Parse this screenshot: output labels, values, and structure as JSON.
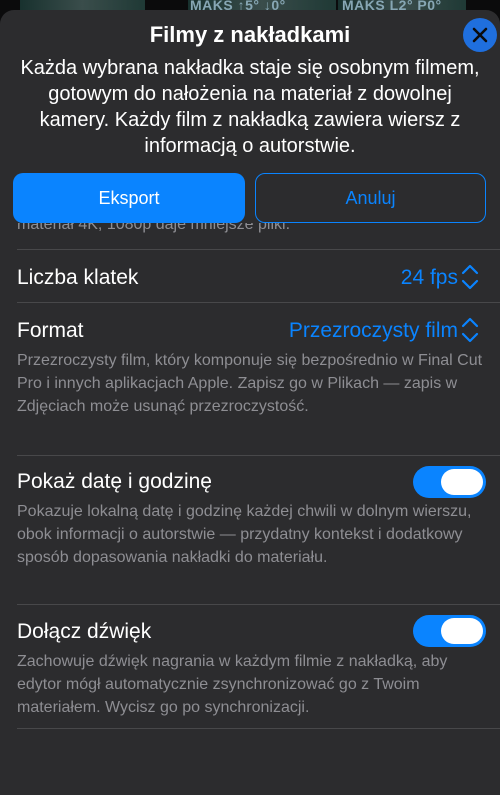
{
  "backdrop": {
    "stat1": "MAKS ↑5° ↓0°",
    "stat2": "MAKS L2° P0°"
  },
  "sheet": {
    "title": "Filmy z nakładkami",
    "description": "Każda wybrana nakładka staje się osobnym filmem, gotowym do nałożenia na materiał z dowolnej kamery. Każdy film z nakładką zawiera wiersz z informacją o autorstwie.",
    "close_icon": "close-x-icon"
  },
  "actions": {
    "export_label": "Eksport",
    "cancel_label": "Anuluj"
  },
  "settings": {
    "clipped_text": "materiał 4K, 1080p daje mniejsze pliki.",
    "frame_rate": {
      "label": "Liczba klatek",
      "value": "24 fps"
    },
    "format": {
      "label": "Format",
      "value": "Przezroczysty film",
      "description": "Przezroczysty film, który komponuje się bezpośrednio w Final Cut Pro i innych aplikacjach Apple. Zapisz go w Plikach — zapis w Zdjęciach może usunąć przezroczystość."
    },
    "show_datetime": {
      "label": "Pokaż datę i godzinę",
      "enabled": true,
      "description": "Pokazuje lokalną datę i godzinę każdej chwili w dolnym wierszu, obok informacji o autorstwie — przydatny kontekst i dodatkowy sposób dopasowania nakładki do materiału."
    },
    "include_sound": {
      "label": "Dołącz dźwięk",
      "enabled": true,
      "description": "Zachowuje dźwięk nagrania w każdym filmie z nakładką, aby edytor mógł automatycznie zsynchronizować go z Twoim materiałem. Wycisz go po synchronizacji."
    }
  },
  "colors": {
    "accent": "#0a84ff",
    "sheet_background": "#2c2c2e",
    "secondary_text": "#8e8e93"
  }
}
